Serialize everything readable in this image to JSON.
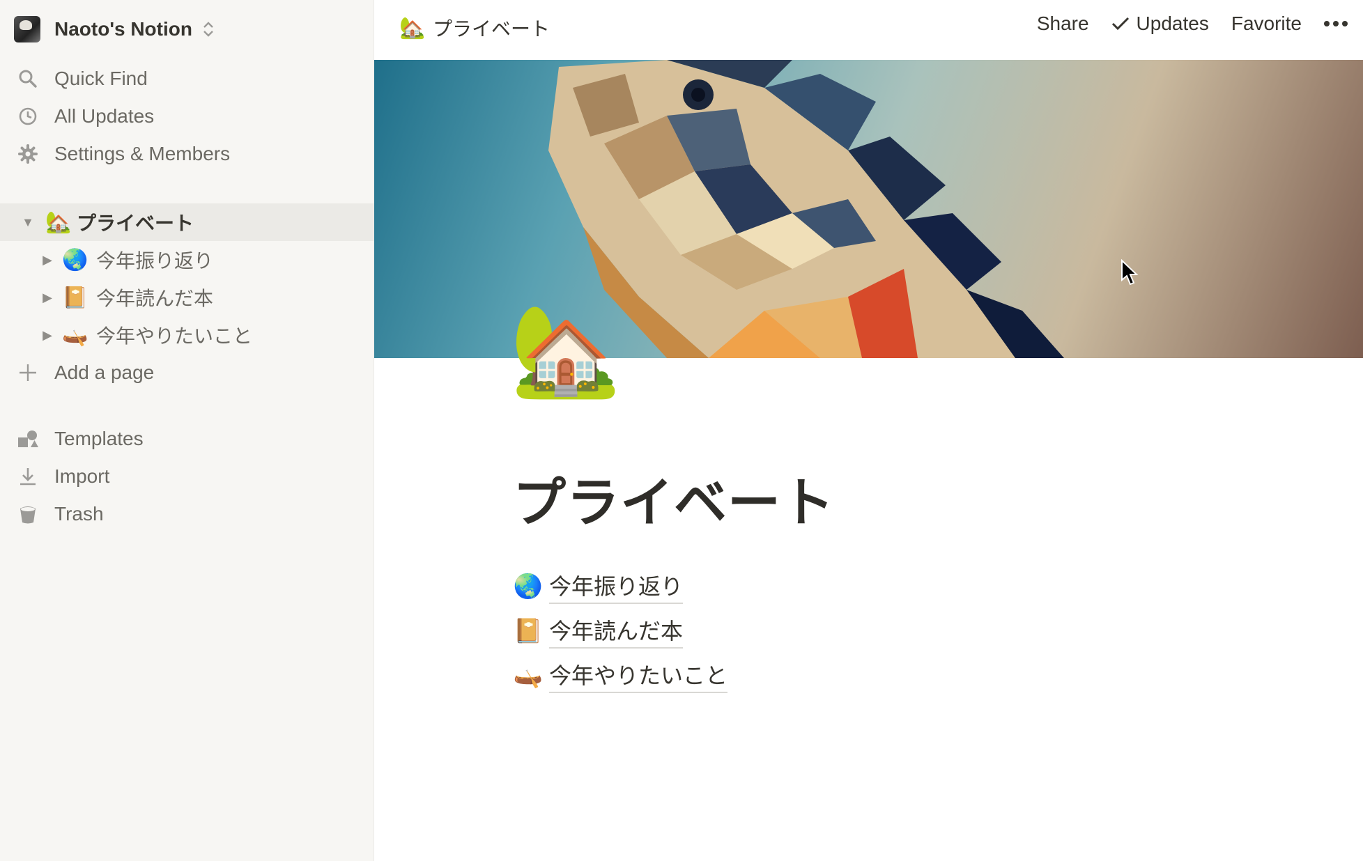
{
  "workspace": {
    "name": "Naoto's Notion"
  },
  "sidebar": {
    "nav": [
      {
        "label": "Quick Find",
        "icon": "search-icon"
      },
      {
        "label": "All Updates",
        "icon": "clock-icon"
      },
      {
        "label": "Settings & Members",
        "icon": "gear-icon"
      }
    ],
    "tree": {
      "root": {
        "emoji": "🏡",
        "label": "プライベート"
      },
      "children": [
        {
          "emoji": "🌏",
          "label": "今年振り返り"
        },
        {
          "emoji": "📔",
          "label": "今年読んだ本"
        },
        {
          "emoji": "🛶",
          "label": "今年やりたいこと"
        }
      ],
      "add_page": "Add a page"
    },
    "footer": [
      {
        "label": "Templates",
        "icon": "templates-icon"
      },
      {
        "label": "Import",
        "icon": "import-icon"
      },
      {
        "label": "Trash",
        "icon": "trash-icon"
      }
    ]
  },
  "topbar": {
    "breadcrumb_emoji": "🏡",
    "breadcrumb_title": "プライベート",
    "share": "Share",
    "updates": "Updates",
    "favorite": "Favorite"
  },
  "page": {
    "icon": "🏡",
    "title": "プライベート",
    "subpages": [
      {
        "emoji": "🌏",
        "label": "今年振り返り"
      },
      {
        "emoji": "📔",
        "label": "今年読んだ本"
      },
      {
        "emoji": "🛶",
        "label": "今年やりたいこと"
      }
    ]
  }
}
